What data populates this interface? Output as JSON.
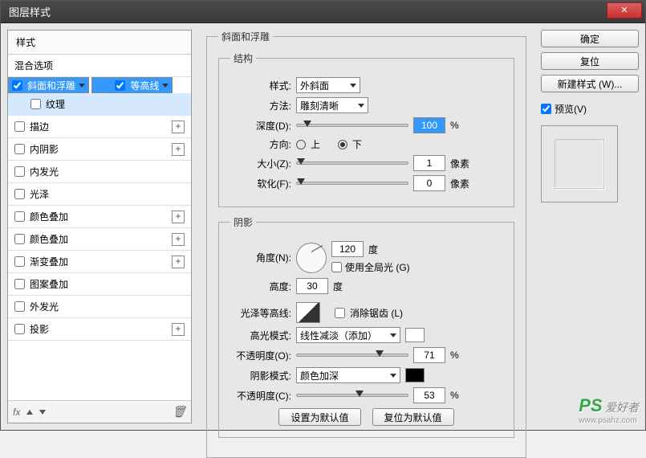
{
  "window": {
    "title": "图层样式",
    "close": "✕"
  },
  "left": {
    "header": "样式",
    "blending": "混合选项",
    "items": [
      {
        "label": "斜面和浮雕",
        "checked": true,
        "selected": true,
        "expandable": false
      },
      {
        "label": "等高线",
        "checked": true,
        "sub": true
      },
      {
        "label": "纹理",
        "checked": false,
        "sub": true
      },
      {
        "label": "描边",
        "checked": false,
        "expandable": true
      },
      {
        "label": "内阴影",
        "checked": false,
        "expandable": true
      },
      {
        "label": "内发光",
        "checked": false
      },
      {
        "label": "光泽",
        "checked": false
      },
      {
        "label": "颜色叠加",
        "checked": false,
        "expandable": true
      },
      {
        "label": "颜色叠加",
        "checked": false,
        "expandable": true
      },
      {
        "label": "渐变叠加",
        "checked": false,
        "expandable": true
      },
      {
        "label": "图案叠加",
        "checked": false
      },
      {
        "label": "外发光",
        "checked": false
      },
      {
        "label": "投影",
        "checked": false,
        "expandable": true
      }
    ],
    "fx": "fx"
  },
  "bevel": {
    "group_title": "斜面和浮雕",
    "structure_title": "结构",
    "style_lbl": "样式:",
    "style_val": "外斜面",
    "method_lbl": "方法:",
    "method_val": "雕刻清晰",
    "depth_lbl": "深度(D):",
    "depth_val": "100",
    "depth_unit": "%",
    "direction_lbl": "方向:",
    "dir_up": "上",
    "dir_down": "下",
    "size_lbl": "大小(Z):",
    "size_val": "1",
    "size_unit": "像素",
    "soften_lbl": "软化(F):",
    "soften_val": "0",
    "soften_unit": "像素"
  },
  "shading": {
    "title": "阴影",
    "angle_lbl": "角度(N):",
    "angle_val": "120",
    "angle_unit": "度",
    "global_lbl": "使用全局光 (G)",
    "altitude_lbl": "高度:",
    "altitude_val": "30",
    "altitude_unit": "度",
    "gloss_lbl": "光泽等高线:",
    "antialias_lbl": "消除锯齿 (L)",
    "highlight_mode_lbl": "高光模式:",
    "highlight_mode_val": "线性减淡（添加）",
    "highlight_op_lbl": "不透明度(O):",
    "highlight_op_val": "71",
    "highlight_op_unit": "%",
    "shadow_mode_lbl": "阴影模式:",
    "shadow_mode_val": "颜色加深",
    "shadow_op_lbl": "不透明度(C):",
    "shadow_op_val": "53",
    "shadow_op_unit": "%",
    "make_default": "设置为默认值",
    "reset_default": "复位为默认值"
  },
  "right": {
    "ok": "确定",
    "cancel": "复位",
    "new_style": "新建样式 (W)...",
    "preview_lbl": "预览(V)"
  },
  "watermark": {
    "ps": "PS",
    "text": "爱好者",
    "url": "www.psahz.com"
  }
}
